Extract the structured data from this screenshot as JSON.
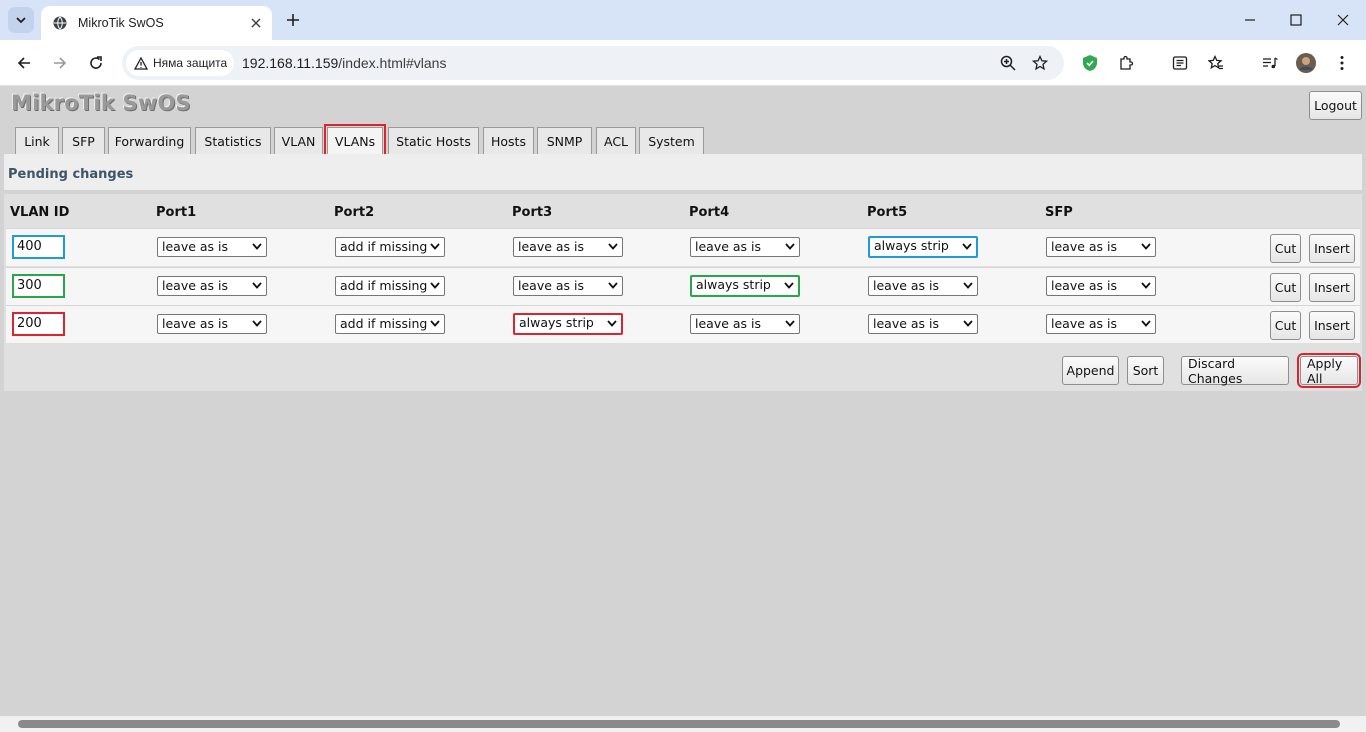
{
  "browser": {
    "tab_title": "MikroTik SwOS",
    "security_label": "Няма защита",
    "url_host": "192.168.11.159",
    "url_path": "/index.html#vlans"
  },
  "app": {
    "brand": "MikroTik SwOS",
    "logout_label": "Logout",
    "tabs": [
      "Link",
      "SFP",
      "Forwarding",
      "Statistics",
      "VLAN",
      "VLANs",
      "Static Hosts",
      "Hosts",
      "SNMP",
      "ACL",
      "System"
    ],
    "active_tab": "VLANs",
    "pending_label": "Pending changes"
  },
  "vlans": {
    "headers": [
      "VLAN ID",
      "Port1",
      "Port2",
      "Port3",
      "Port4",
      "Port5",
      "SFP"
    ],
    "rows": [
      {
        "id": "400",
        "ports": [
          "leave as is",
          "add if missing",
          "leave as is",
          "leave as is",
          "always strip",
          "leave as is"
        ],
        "highlight": "#1f9bd7",
        "highlight_port": 4
      },
      {
        "id": "300",
        "ports": [
          "leave as is",
          "add if missing",
          "leave as is",
          "always strip",
          "leave as is",
          "leave as is"
        ],
        "highlight": "#2aa54b",
        "highlight_port": 3
      },
      {
        "id": "200",
        "ports": [
          "leave as is",
          "add if missing",
          "always strip",
          "leave as is",
          "leave as is",
          "leave as is"
        ],
        "highlight": "#d9252e",
        "highlight_port": 2
      }
    ],
    "cut_label": "Cut",
    "insert_label": "Insert"
  },
  "actions": {
    "append": "Append",
    "sort": "Sort",
    "discard": "Discard Changes",
    "apply": "Apply All"
  }
}
